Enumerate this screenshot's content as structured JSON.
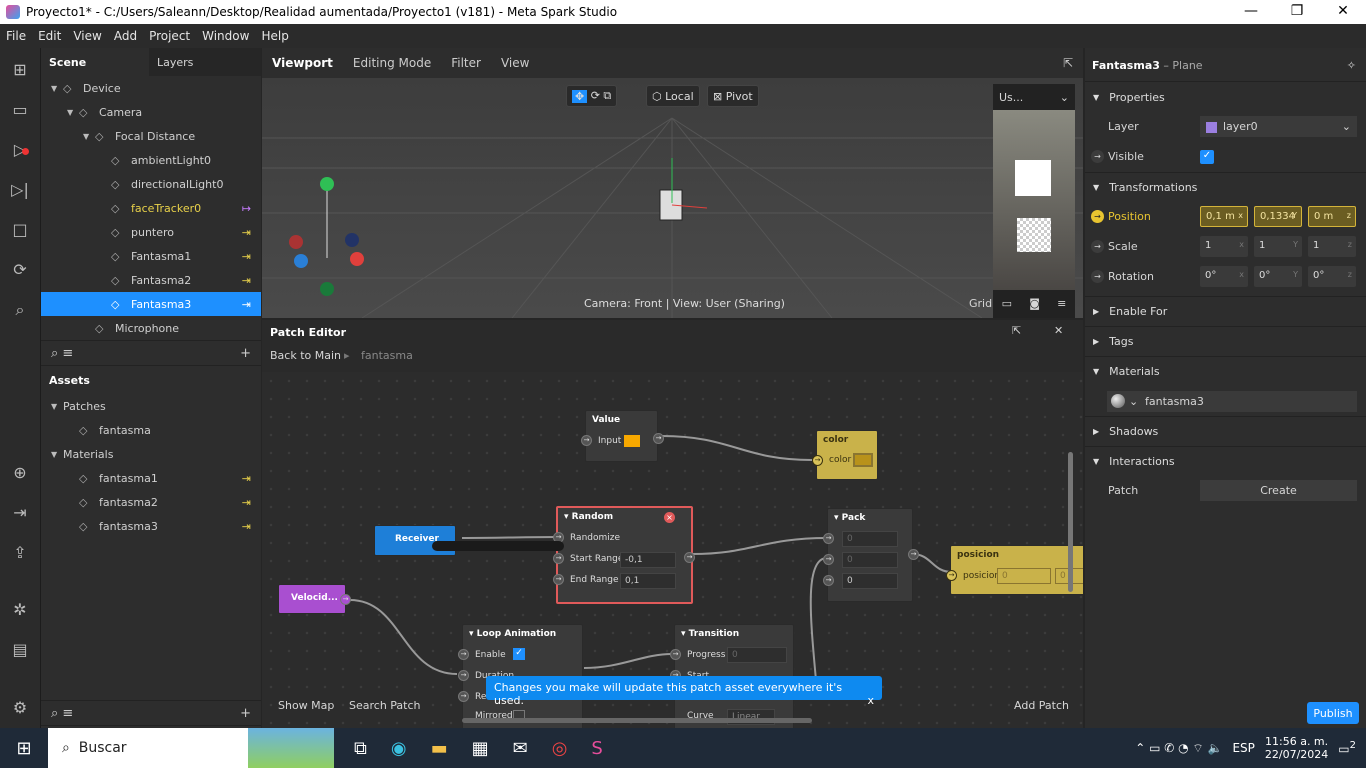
{
  "window": {
    "title": "Proyecto1* - C:/Users/Saleann/Desktop/Realidad aumentada/Proyecto1 (v181) - Meta Spark Studio"
  },
  "menu": [
    "File",
    "Edit",
    "View",
    "Add",
    "Project",
    "Window",
    "Help"
  ],
  "scene": {
    "tabs": [
      "Scene",
      "Layers"
    ],
    "items": [
      {
        "label": "Device",
        "icon": "phone-icon",
        "depth": 0,
        "tw": "▼"
      },
      {
        "label": "Camera",
        "icon": "camera-icon",
        "depth": 1,
        "tw": "▼"
      },
      {
        "label": "Focal Distance",
        "icon": "focal-icon",
        "depth": 2,
        "tw": "▼"
      },
      {
        "label": "ambientLight0",
        "icon": "globe-icon",
        "depth": 3
      },
      {
        "label": "directionalLight0",
        "icon": "light-icon",
        "depth": 3
      },
      {
        "label": "faceTracker0",
        "icon": "face-tracker-icon",
        "depth": 3,
        "link": "↦"
      },
      {
        "label": "puntero",
        "icon": "plane-icon",
        "depth": 3,
        "link": "⇥"
      },
      {
        "label": "Fantasma1",
        "icon": "plane-icon",
        "depth": 3,
        "link": "⇥"
      },
      {
        "label": "Fantasma2",
        "icon": "plane-icon",
        "depth": 3,
        "link": "⇥"
      },
      {
        "label": "Fantasma3",
        "icon": "plane-icon",
        "depth": 3,
        "link": "⇥",
        "selected": true
      },
      {
        "label": "Microphone",
        "icon": "microphone-icon",
        "depth": 2
      }
    ]
  },
  "assets": {
    "title": "Assets",
    "items": [
      {
        "label": "Patches",
        "tw": "▼",
        "depth": 0
      },
      {
        "label": "fantasma",
        "icon": "patch-icon",
        "depth": 1
      },
      {
        "label": "Materials",
        "tw": "▼",
        "depth": 0
      },
      {
        "label": "fantasma1",
        "icon": "material-icon",
        "depth": 1,
        "link": "⇥"
      },
      {
        "label": "fantasma2",
        "icon": "material-icon",
        "depth": 1,
        "link": "⇥"
      },
      {
        "label": "fantasma3",
        "icon": "material-icon",
        "depth": 1,
        "link": "⇥"
      }
    ]
  },
  "viewport": {
    "tabs": [
      "Viewport",
      "Editing Mode",
      "Filter",
      "View"
    ],
    "local": "Local",
    "pivot": "Pivot",
    "status": "Camera: Front | View: User (Sharing)",
    "grid": "Grid",
    "preview_select": "Us..."
  },
  "patch": {
    "title": "Patch Editor",
    "back": "Back to Main",
    "crumb": "fantasma",
    "show_map": "Show Map",
    "search": "Search Patch",
    "add": "Add Patch",
    "toast": "Changes you make will update this patch asset everywhere it's used.",
    "nodes": {
      "value": {
        "title": "Value",
        "input": "Input"
      },
      "color": {
        "title": "color",
        "port": "color"
      },
      "random": {
        "title": "Random",
        "randomize": "Randomize",
        "start": "Start Range",
        "start_val": "-0,1",
        "end": "End Range",
        "end_val": "0,1"
      },
      "receiver": {
        "title": "Receiver"
      },
      "pack": {
        "title": "Pack",
        "v1": "0",
        "v2": "0",
        "v3": "0"
      },
      "posicion": {
        "title": "posicion",
        "port": "posicion",
        "x": "0",
        "y": "0"
      },
      "velocidad": {
        "title": "Velocid..."
      },
      "loop": {
        "title": "Loop Animation",
        "enable": "Enable",
        "duration": "Duration",
        "reset": "Re",
        "mirrored": "Mirrored"
      },
      "transition": {
        "title": "Transition",
        "progress": "Progress",
        "progress_val": "0",
        "start": "Start",
        "curve": "Curve",
        "curve_val": "Linear"
      }
    }
  },
  "inspector": {
    "name": "Fantasma3",
    "type": "– Plane",
    "properties": "Properties",
    "layer_label": "Layer",
    "layer": "layer0",
    "layer_color": "#9b7fe0",
    "visible_label": "Visible",
    "visible": true,
    "transformations": "Transformations",
    "position": {
      "label": "Position",
      "x": "0,1 m",
      "y": "0,1334",
      "z": "0 m"
    },
    "scale": {
      "label": "Scale",
      "x": "1",
      "y": "1",
      "z": "1"
    },
    "rotation": {
      "label": "Rotation",
      "x": "0°",
      "y": "0°",
      "z": "0°"
    },
    "sections": [
      "Enable For",
      "Tags",
      "Materials"
    ],
    "material": "fantasma3",
    "shadows": "Shadows",
    "interactions": "Interactions",
    "patch_label": "Patch",
    "create": "Create",
    "publish": "Publish"
  },
  "taskbar": {
    "search": "Buscar",
    "lang": "ESP",
    "time": "11:56 a. m.",
    "date": "22/07/2024",
    "notif": "2"
  },
  "colors": {
    "accent": "#1e90ff",
    "link": "#e8d14a",
    "yellow_node": "#c9b24a",
    "purple_node": "#a94fd0",
    "receiver": "#1e7fd8"
  }
}
